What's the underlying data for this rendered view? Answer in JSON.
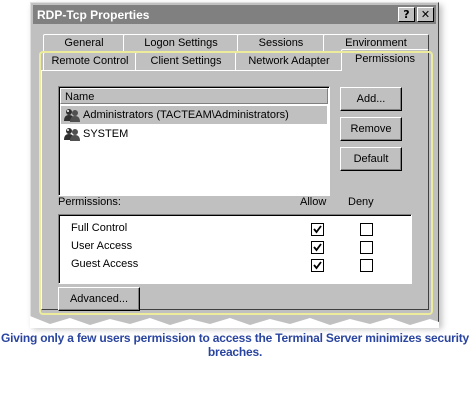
{
  "window": {
    "title": "RDP-Tcp Properties",
    "help_btn": "?",
    "close_btn": "✕"
  },
  "tabs": {
    "row_back": [
      "General",
      "Logon Settings",
      "Sessions",
      "Environment"
    ],
    "row_front": [
      "Remote Control",
      "Client Settings",
      "Network Adapter",
      "Permissions"
    ],
    "active": "Permissions"
  },
  "names_list": {
    "header": "Name",
    "items": [
      {
        "label": "Administrators (TACTEAM\\Administrators)",
        "icon": "user-group-icon",
        "selected": true
      },
      {
        "label": "SYSTEM",
        "icon": "user-group-icon",
        "selected": false
      }
    ]
  },
  "buttons": {
    "add": "Add...",
    "remove": "Remove",
    "default": "Default",
    "advanced": "Advanced..."
  },
  "permissions": {
    "label": "Permissions:",
    "allow_header": "Allow",
    "deny_header": "Deny",
    "rows": [
      {
        "name": "Full Control",
        "allow": true,
        "deny": false
      },
      {
        "name": "User Access",
        "allow": true,
        "deny": false
      },
      {
        "name": "Guest Access",
        "allow": true,
        "deny": false
      }
    ]
  },
  "caption": "Giving only a few users permission to access the Terminal Server minimizes security breaches.",
  "colors": {
    "caption": "#2a45a0",
    "highlight": "#ecec9c",
    "titlebar": "#808080"
  }
}
